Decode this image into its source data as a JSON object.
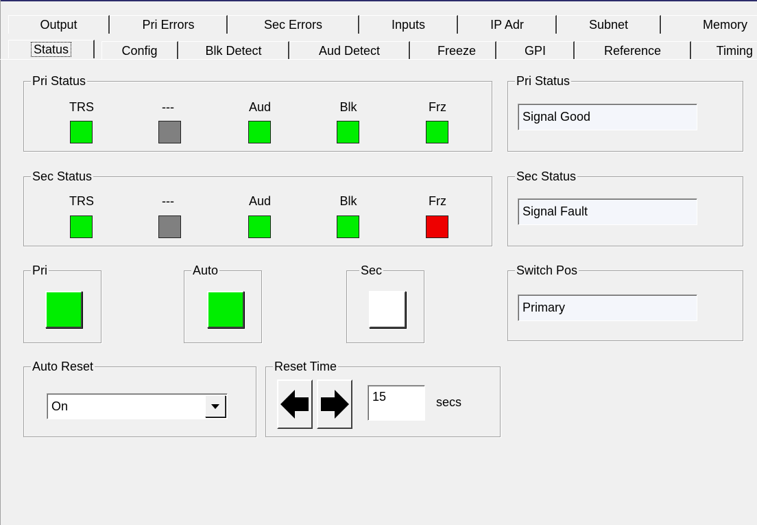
{
  "tabs_row1": [
    "Output",
    "Pri Errors",
    "Sec Errors",
    "Inputs",
    "IP Adr",
    "Subnet",
    "Memory"
  ],
  "tabs_row2": [
    "Status",
    "Config",
    "Blk Detect",
    "Aud Detect",
    "Freeze",
    "GPI",
    "Reference",
    "Timing"
  ],
  "active_tab": "Status",
  "pri_status_group": {
    "title": "Pri Status",
    "indicators": [
      {
        "label": "TRS",
        "color": "#00ee00"
      },
      {
        "label": "---",
        "color": "#808080"
      },
      {
        "label": "Aud",
        "color": "#00ee00"
      },
      {
        "label": "Blk",
        "color": "#00ee00"
      },
      {
        "label": "Frz",
        "color": "#00ee00"
      }
    ]
  },
  "sec_status_group": {
    "title": "Sec Status",
    "indicators": [
      {
        "label": "TRS",
        "color": "#00ee00"
      },
      {
        "label": "---",
        "color": "#808080"
      },
      {
        "label": "Aud",
        "color": "#00ee00"
      },
      {
        "label": "Blk",
        "color": "#00ee00"
      },
      {
        "label": "Frz",
        "color": "#ee0000"
      }
    ]
  },
  "pri_status_text": {
    "title": "Pri Status",
    "value": "Signal Good"
  },
  "sec_status_text": {
    "title": "Sec Status",
    "value": "Signal Fault"
  },
  "switch_pos": {
    "title": "Switch Pos",
    "value": "Primary"
  },
  "switch_buttons": {
    "pri": {
      "title": "Pri",
      "color": "#00ee00"
    },
    "auto": {
      "title": "Auto",
      "color": "#00ee00"
    },
    "sec": {
      "title": "Sec",
      "color": "#ffffff"
    }
  },
  "auto_reset": {
    "title": "Auto Reset",
    "value": "On"
  },
  "reset_time": {
    "title": "Reset Time",
    "value": "15",
    "unit": "secs",
    "left_icon": "arrow-left-icon",
    "right_icon": "arrow-right-icon"
  }
}
